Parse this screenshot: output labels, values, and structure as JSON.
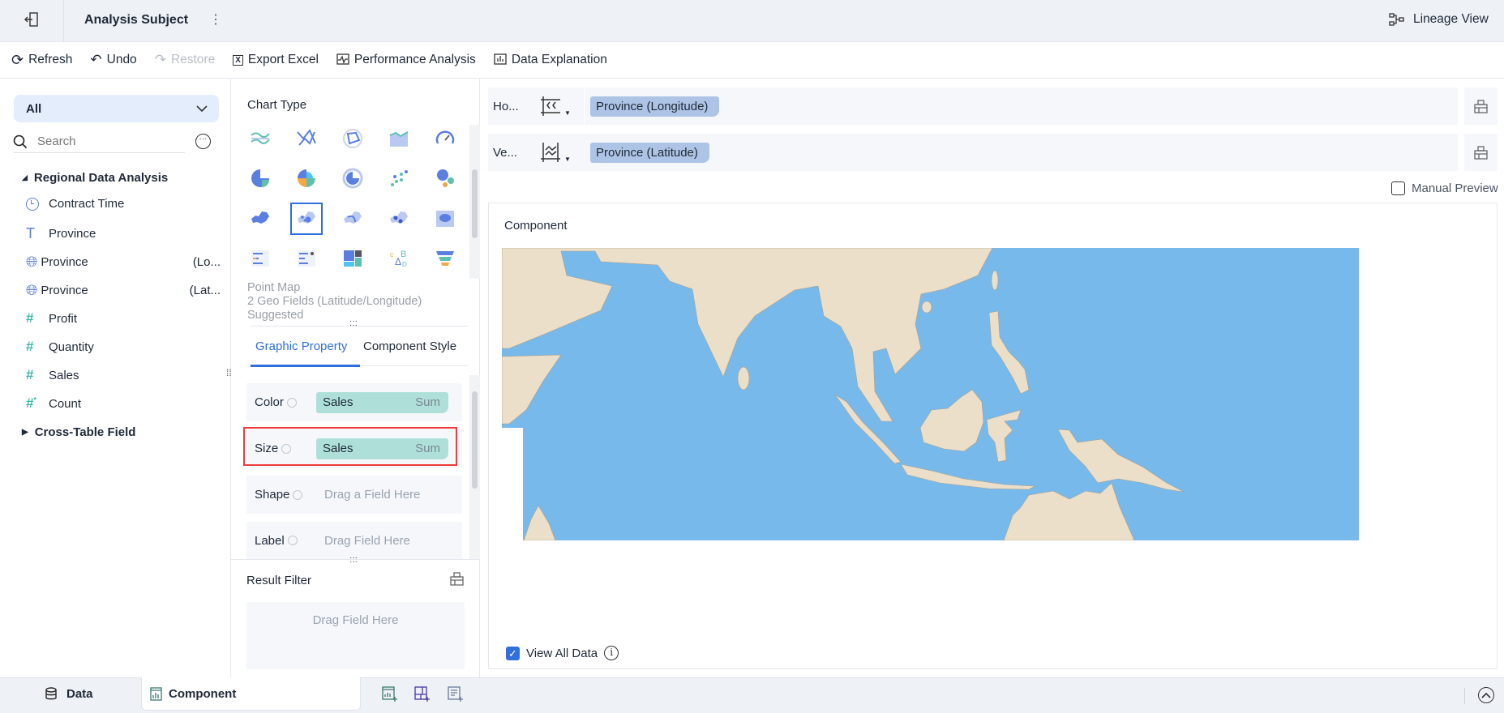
{
  "header": {
    "title": "Analysis Subject",
    "lineage": "Lineage View"
  },
  "toolbar": {
    "refresh": "Refresh",
    "undo": "Undo",
    "restore": "Restore",
    "export": "Export Excel",
    "performance": "Performance Analysis",
    "explanation": "Data Explanation"
  },
  "left": {
    "dropdown": "All",
    "search_placeholder": "Search",
    "group1": "Regional Data Analysis",
    "fields": [
      {
        "label": "Contract Time",
        "suffix": ""
      },
      {
        "label": "Province",
        "suffix": ""
      },
      {
        "label": "Province",
        "suffix": "(Lo..."
      },
      {
        "label": "Province",
        "suffix": "(Lat..."
      },
      {
        "label": "Profit",
        "suffix": ""
      },
      {
        "label": "Quantity",
        "suffix": ""
      },
      {
        "label": "Sales",
        "suffix": ""
      },
      {
        "label": "Count",
        "suffix": ""
      }
    ],
    "group2": "Cross-Table Field"
  },
  "chart_type": {
    "title": "Chart Type",
    "selected": "Point Map",
    "hint1": "2 Geo Fields (Latitude/Longitude)",
    "hint2": "Suggested"
  },
  "tabs": {
    "graphic": "Graphic Property",
    "style": "Component Style"
  },
  "properties": {
    "color": {
      "label": "Color",
      "field": "Sales",
      "agg": "Sum"
    },
    "size": {
      "label": "Size",
      "field": "Sales",
      "agg": "Sum"
    },
    "shape": {
      "label": "Shape",
      "placeholder": "Drag a Field Here"
    },
    "label": {
      "label": "Label",
      "placeholder": "Drag Field Here"
    }
  },
  "filter": {
    "title": "Result Filter",
    "placeholder": "Drag Field Here"
  },
  "axes": {
    "h_label": "Ho...",
    "h_field": "Province (Longitude)",
    "v_label": "Ve...",
    "v_field": "Province (Latitude)"
  },
  "preview": {
    "manual": "Manual Preview",
    "component_title": "Component",
    "view_all": "View All Data"
  },
  "bottom": {
    "data": "Data",
    "component": "Component"
  },
  "colors": {
    "accent": "#2f6fde",
    "sea": "#77b9eb",
    "land": "#ebdfc9",
    "pill_measure": "#aee0d9",
    "pill_dim": "#aec4e6"
  }
}
